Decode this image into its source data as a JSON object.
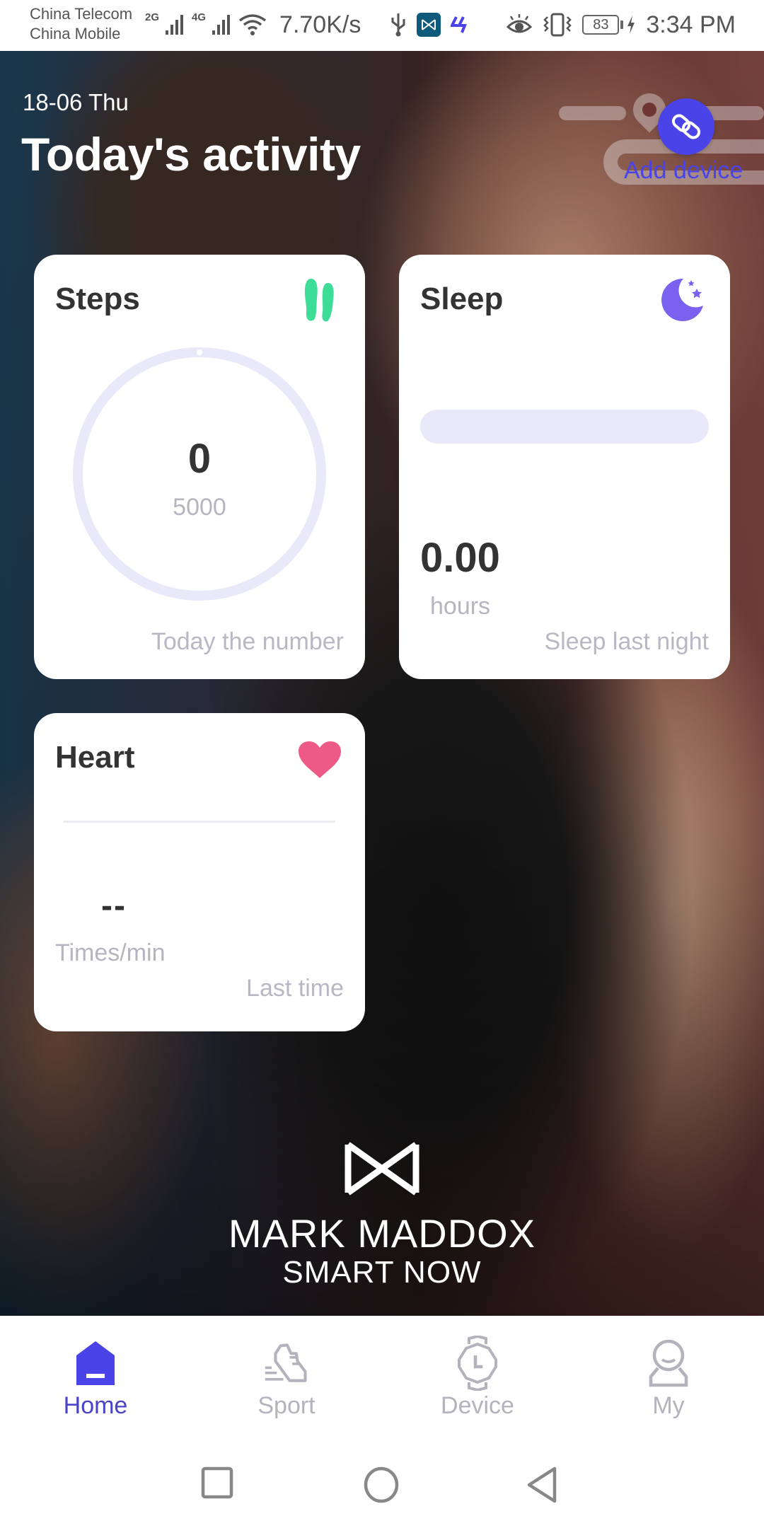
{
  "status_bar": {
    "carrier_1": "China Telecom",
    "carrier_2": "China Mobile",
    "network_1": "2G",
    "network_2": "4G",
    "net_speed": "7.70K/s",
    "battery": "83",
    "time": "3:34 PM"
  },
  "header": {
    "date": "18-06 Thu",
    "title": "Today's activity",
    "add_device_label": "Add device"
  },
  "cards": {
    "steps": {
      "title": "Steps",
      "value": "0",
      "goal": "5000",
      "progress_fraction": 0,
      "footer": "Today the number",
      "icon": "footprints-icon",
      "color": "#3ddc97"
    },
    "sleep": {
      "title": "Sleep",
      "value": "0.00",
      "unit": "hours",
      "progress_fraction": 0,
      "footer": "Sleep last night",
      "icon": "moon-stars-icon",
      "color": "#7b61f0"
    },
    "heart": {
      "title": "Heart",
      "value": "--",
      "unit": "Times/min",
      "footer": "Last time",
      "icon": "heart-icon",
      "color": "#ee5a86"
    }
  },
  "brand": {
    "name": "MARK MADDOX",
    "tagline": "SMART NOW"
  },
  "bottom_nav": {
    "items": [
      {
        "label": "Home",
        "icon": "home-icon",
        "active": true
      },
      {
        "label": "Sport",
        "icon": "sneaker-icon",
        "active": false
      },
      {
        "label": "Device",
        "icon": "watch-icon",
        "active": false
      },
      {
        "label": "My",
        "icon": "user-icon",
        "active": false
      }
    ]
  },
  "colors": {
    "accent": "#4a43e8",
    "inactive": "#b3b3bd",
    "track": "#eae9fa"
  }
}
